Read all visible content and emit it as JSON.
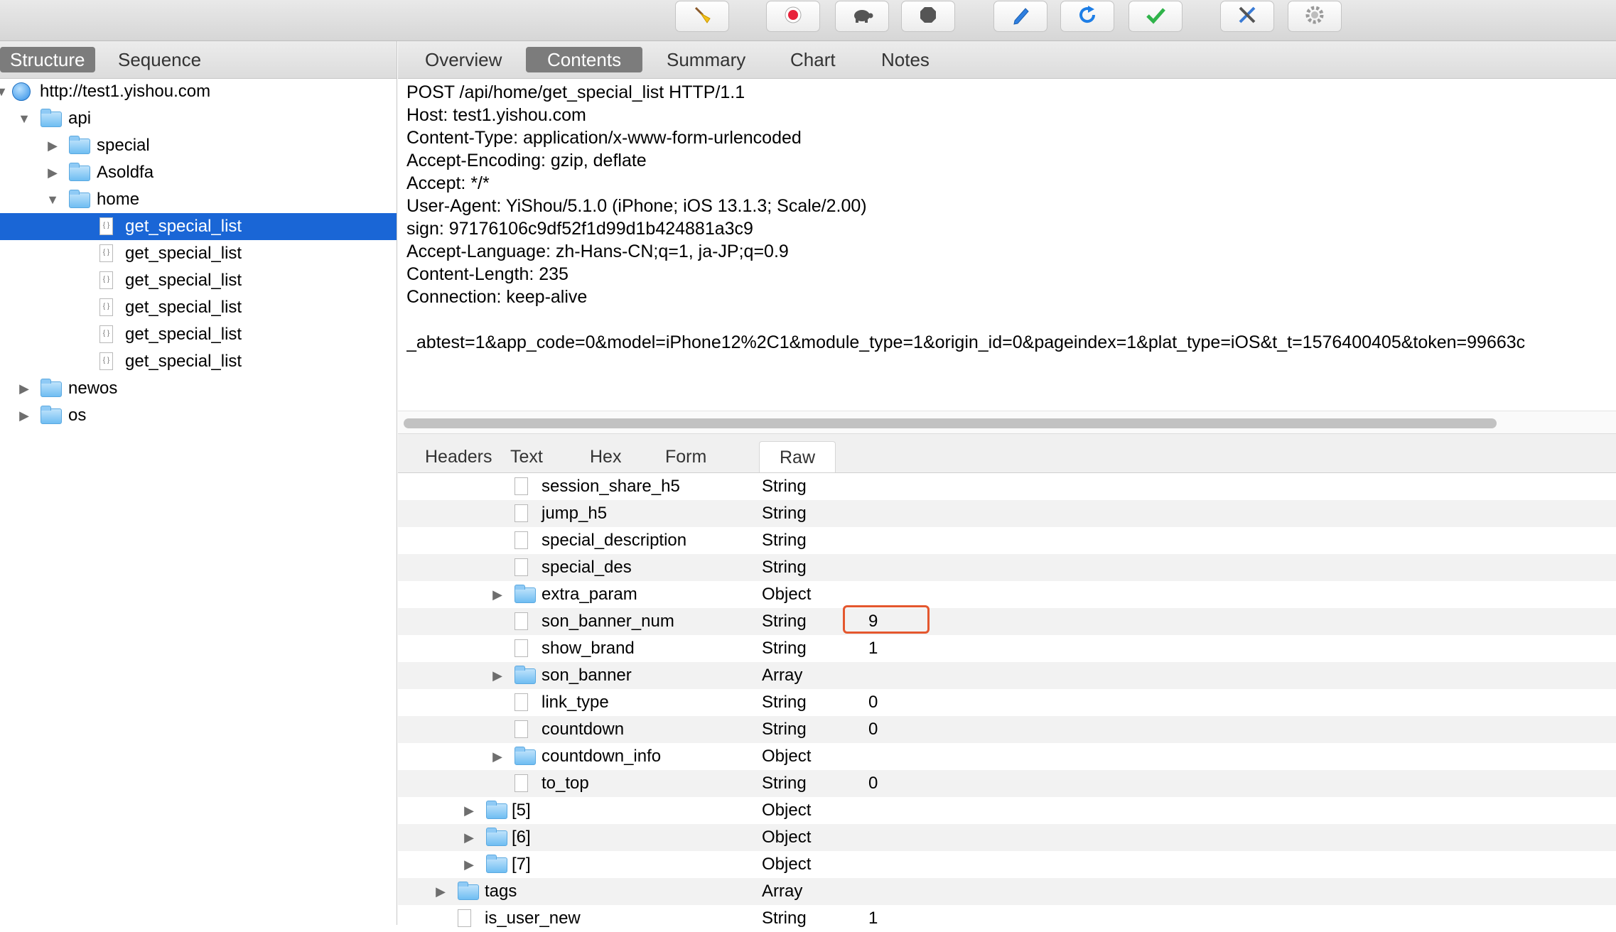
{
  "toolbar": {
    "buttons": [
      {
        "icon": "broom-icon"
      },
      {
        "icon": "record-icon"
      },
      {
        "icon": "turtle-icon"
      },
      {
        "icon": "stop-icon"
      },
      {
        "icon": "pen-icon"
      },
      {
        "icon": "refresh-icon"
      },
      {
        "icon": "checkmark-icon"
      },
      {
        "icon": "tools-icon"
      },
      {
        "icon": "settings-gear-icon"
      }
    ]
  },
  "left": {
    "tabs": [
      {
        "label": "Structure"
      },
      {
        "label": "Sequence"
      }
    ],
    "tree": [
      {
        "label": "http://test1.yishou.com"
      },
      {
        "label": "api"
      },
      {
        "label": "special"
      },
      {
        "label": "Asoldfa"
      },
      {
        "label": "home"
      },
      {
        "label": "get_special_list"
      },
      {
        "label": "get_special_list"
      },
      {
        "label": "get_special_list"
      },
      {
        "label": "get_special_list"
      },
      {
        "label": "get_special_list"
      },
      {
        "label": "get_special_list"
      },
      {
        "label": "newos"
      },
      {
        "label": "os"
      }
    ]
  },
  "right": {
    "tabs": [
      {
        "label": "Overview"
      },
      {
        "label": "Contents"
      },
      {
        "label": "Summary"
      },
      {
        "label": "Chart"
      },
      {
        "label": "Notes"
      }
    ],
    "request_lines": [
      "POST /api/home/get_special_list HTTP/1.1",
      "Host: test1.yishou.com",
      "Content-Type: application/x-www-form-urlencoded",
      "Accept-Encoding: gzip, deflate",
      "Accept: */*",
      "User-Agent: YiShou/5.1.0 (iPhone; iOS 13.1.3; Scale/2.00)",
      "sign: 97176106c9df52f1d99d1b424881a3c9",
      "Accept-Language: zh-Hans-CN;q=1, ja-JP;q=0.9",
      "Content-Length: 235",
      "Connection: keep-alive",
      "",
      "_abtest=1&app_code=0&model=iPhone12%2C1&module_type=1&origin_id=0&pageindex=1&plat_type=iOS&t_t=1576400405&token=99663c"
    ],
    "bottom_tabs": [
      {
        "label": "Headers"
      },
      {
        "label": "Text"
      },
      {
        "label": "Hex"
      },
      {
        "label": "Form"
      },
      {
        "label": "Raw"
      }
    ],
    "json_rows": [
      {
        "name": "session_share_h5",
        "type": "String",
        "value": ""
      },
      {
        "name": "jump_h5",
        "type": "String",
        "value": ""
      },
      {
        "name": "special_description",
        "type": "String",
        "value": ""
      },
      {
        "name": "special_des",
        "type": "String",
        "value": ""
      },
      {
        "name": "extra_param",
        "type": "Object",
        "value": ""
      },
      {
        "name": "son_banner_num",
        "type": "String",
        "value": "9"
      },
      {
        "name": "show_brand",
        "type": "String",
        "value": "1"
      },
      {
        "name": "son_banner",
        "type": "Array",
        "value": ""
      },
      {
        "name": "link_type",
        "type": "String",
        "value": "0"
      },
      {
        "name": "countdown",
        "type": "String",
        "value": "0"
      },
      {
        "name": "countdown_info",
        "type": "Object",
        "value": ""
      },
      {
        "name": "to_top",
        "type": "String",
        "value": "0"
      },
      {
        "name": "[5]",
        "type": "Object",
        "value": ""
      },
      {
        "name": "[6]",
        "type": "Object",
        "value": ""
      },
      {
        "name": "[7]",
        "type": "Object",
        "value": ""
      },
      {
        "name": "tags",
        "type": "Array",
        "value": ""
      },
      {
        "name": "is_user_new",
        "type": "String",
        "value": "1"
      }
    ]
  },
  "colors": {
    "selection": "#1a66d6",
    "highlight_box": "#e4572e"
  }
}
